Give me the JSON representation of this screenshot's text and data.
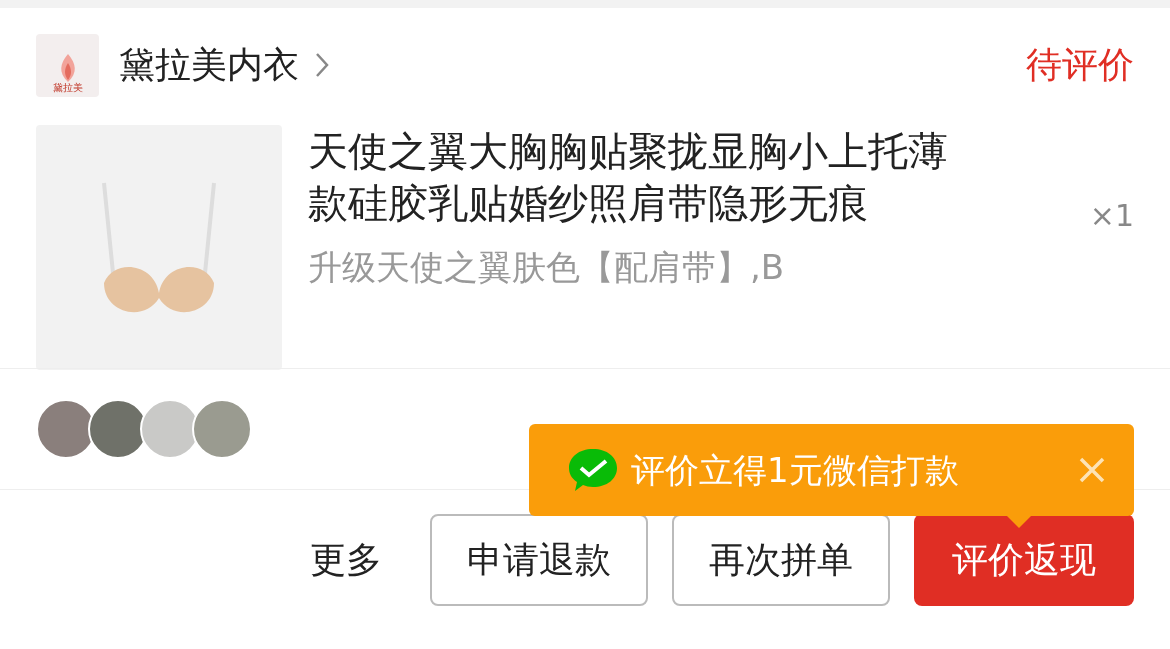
{
  "shop": {
    "logo_text": "黛拉美",
    "name": "黛拉美内衣",
    "status": "待评价"
  },
  "product": {
    "title": "天使之翼大胸胸贴聚拢显胸小上托薄款硅胶乳贴婚纱照肩带隐形无痕",
    "variant": "升级天使之翼肤色【配肩带】,B",
    "quantity": "×1"
  },
  "tooltip": {
    "text": "评价立得1元微信打款"
  },
  "buttons": [
    {
      "label": "更多",
      "kind": "plain"
    },
    {
      "label": "申请退款",
      "kind": "outline"
    },
    {
      "label": "再次拼单",
      "kind": "outline"
    },
    {
      "label": "评价返现",
      "kind": "primary"
    }
  ]
}
